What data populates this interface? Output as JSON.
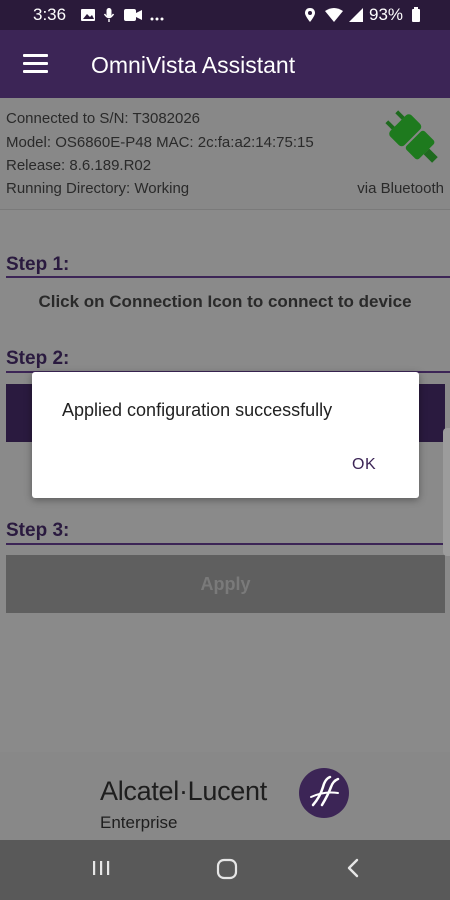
{
  "status_bar": {
    "time": "3:36",
    "battery": "93%",
    "icons_left": [
      "image-icon",
      "mic-icon",
      "video-icon",
      "more-dots-icon"
    ],
    "icons_right": [
      "location-icon",
      "wifi-icon",
      "signal-icon",
      "battery-icon"
    ]
  },
  "app_bar": {
    "title": "OmniVista Assistant",
    "menu_icon": "hamburger-menu-icon"
  },
  "device_info": {
    "line1": "Connected to S/N: T3082026",
    "line2": "Model: OS6860E-P48   MAC: 2c:fa:a2:14:75:15",
    "line3": "Release: 8.6.189.R02",
    "line4": "Running Directory: Working",
    "connection": "via Bluetooth",
    "connection_icon": "connected-plug-icon"
  },
  "steps": {
    "step1_label": "Step 1:",
    "step1_text": "Click on Connection Icon to connect to device",
    "step2_label": "Step 2:",
    "step3_label": "Step 3:",
    "apply_label": "Apply"
  },
  "footer": {
    "brand": "Alcatel·Lucent",
    "sub": "Enterprise"
  },
  "dialog": {
    "message": "Applied configuration successfully",
    "ok_label": "OK"
  },
  "colors": {
    "brand_purple": "#3c2556",
    "accent_green": "#1e7a1e"
  }
}
